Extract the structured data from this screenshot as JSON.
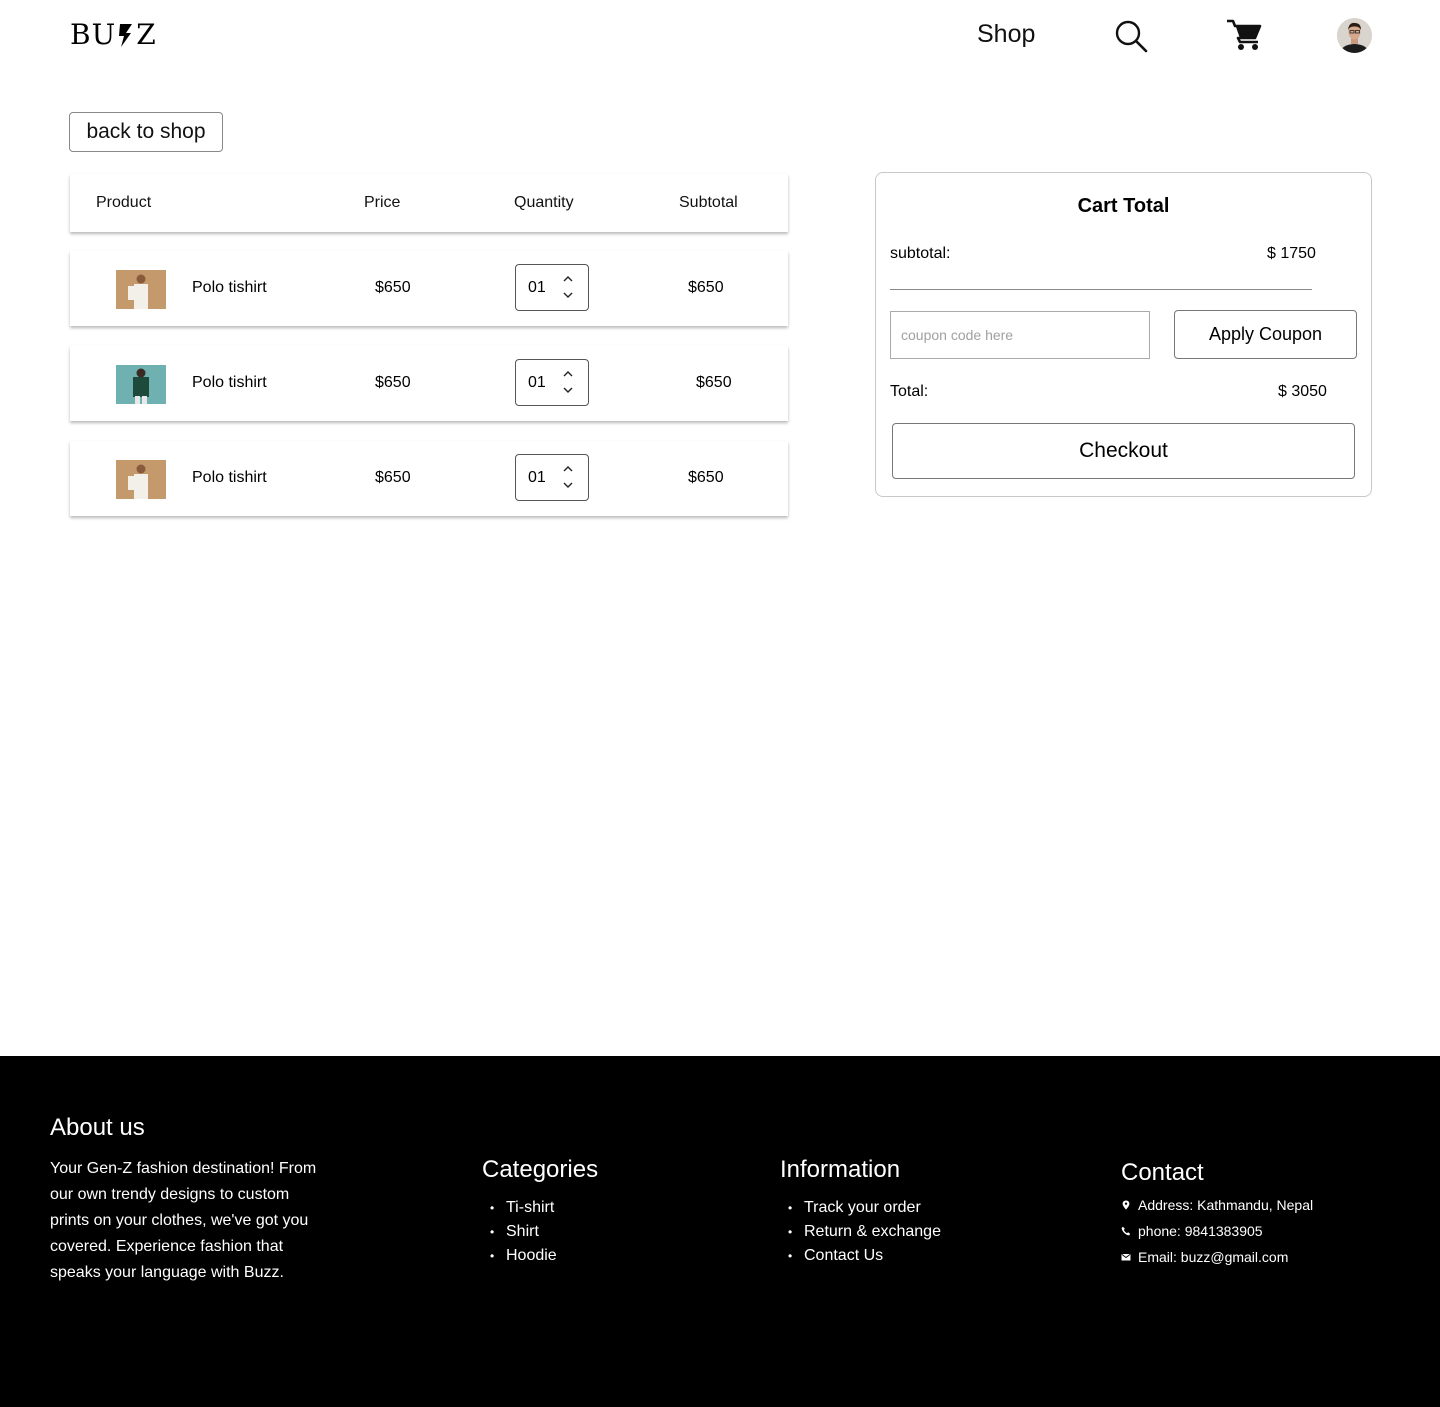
{
  "header": {
    "logo": "BUZZ",
    "nav_shop": "Shop"
  },
  "back_button": "back to shop",
  "cart_table": {
    "columns": [
      "Product",
      "Price",
      "Quantity",
      "Subtotal"
    ],
    "rows": [
      {
        "name": "Polo tishirt",
        "price": "$650",
        "quantity": "01",
        "subtotal": "$650",
        "thumb_color": "#c49a6c"
      },
      {
        "name": "Polo tishirt",
        "price": "$650",
        "quantity": "01",
        "subtotal": "$650",
        "thumb_color": "#6fb0b0"
      },
      {
        "name": "Polo tishirt",
        "price": "$650",
        "quantity": "01",
        "subtotal": "$650",
        "thumb_color": "#c49a6c"
      }
    ]
  },
  "cart_total": {
    "title": "Cart Total",
    "subtotal_label": "subtotal:",
    "subtotal_value": "$ 1750",
    "coupon_placeholder": "coupon code here",
    "apply_label": "Apply Coupon",
    "total_label": "Total:",
    "total_value": "$ 3050",
    "checkout_label": "Checkout"
  },
  "footer": {
    "about_title": "About us",
    "about_text": "Your Gen-Z fashion destination! From our own trendy designs to custom prints on your clothes, we've got you covered. Experience fashion that speaks your language with Buzz.",
    "categories_title": "Categories",
    "categories": [
      "Ti-shirt",
      "Shirt",
      "Hoodie"
    ],
    "information_title": "Information",
    "information": [
      "Track your order",
      "Return & exchange",
      "Contact Us"
    ],
    "contact_title": "Contact",
    "address": "Address: Kathmandu, Nepal",
    "phone": "phone: 9841383905",
    "email": "Email: buzz@gmail.com"
  },
  "colors": {
    "footer_bg": "#000000",
    "page_bg": "#ffffff"
  }
}
